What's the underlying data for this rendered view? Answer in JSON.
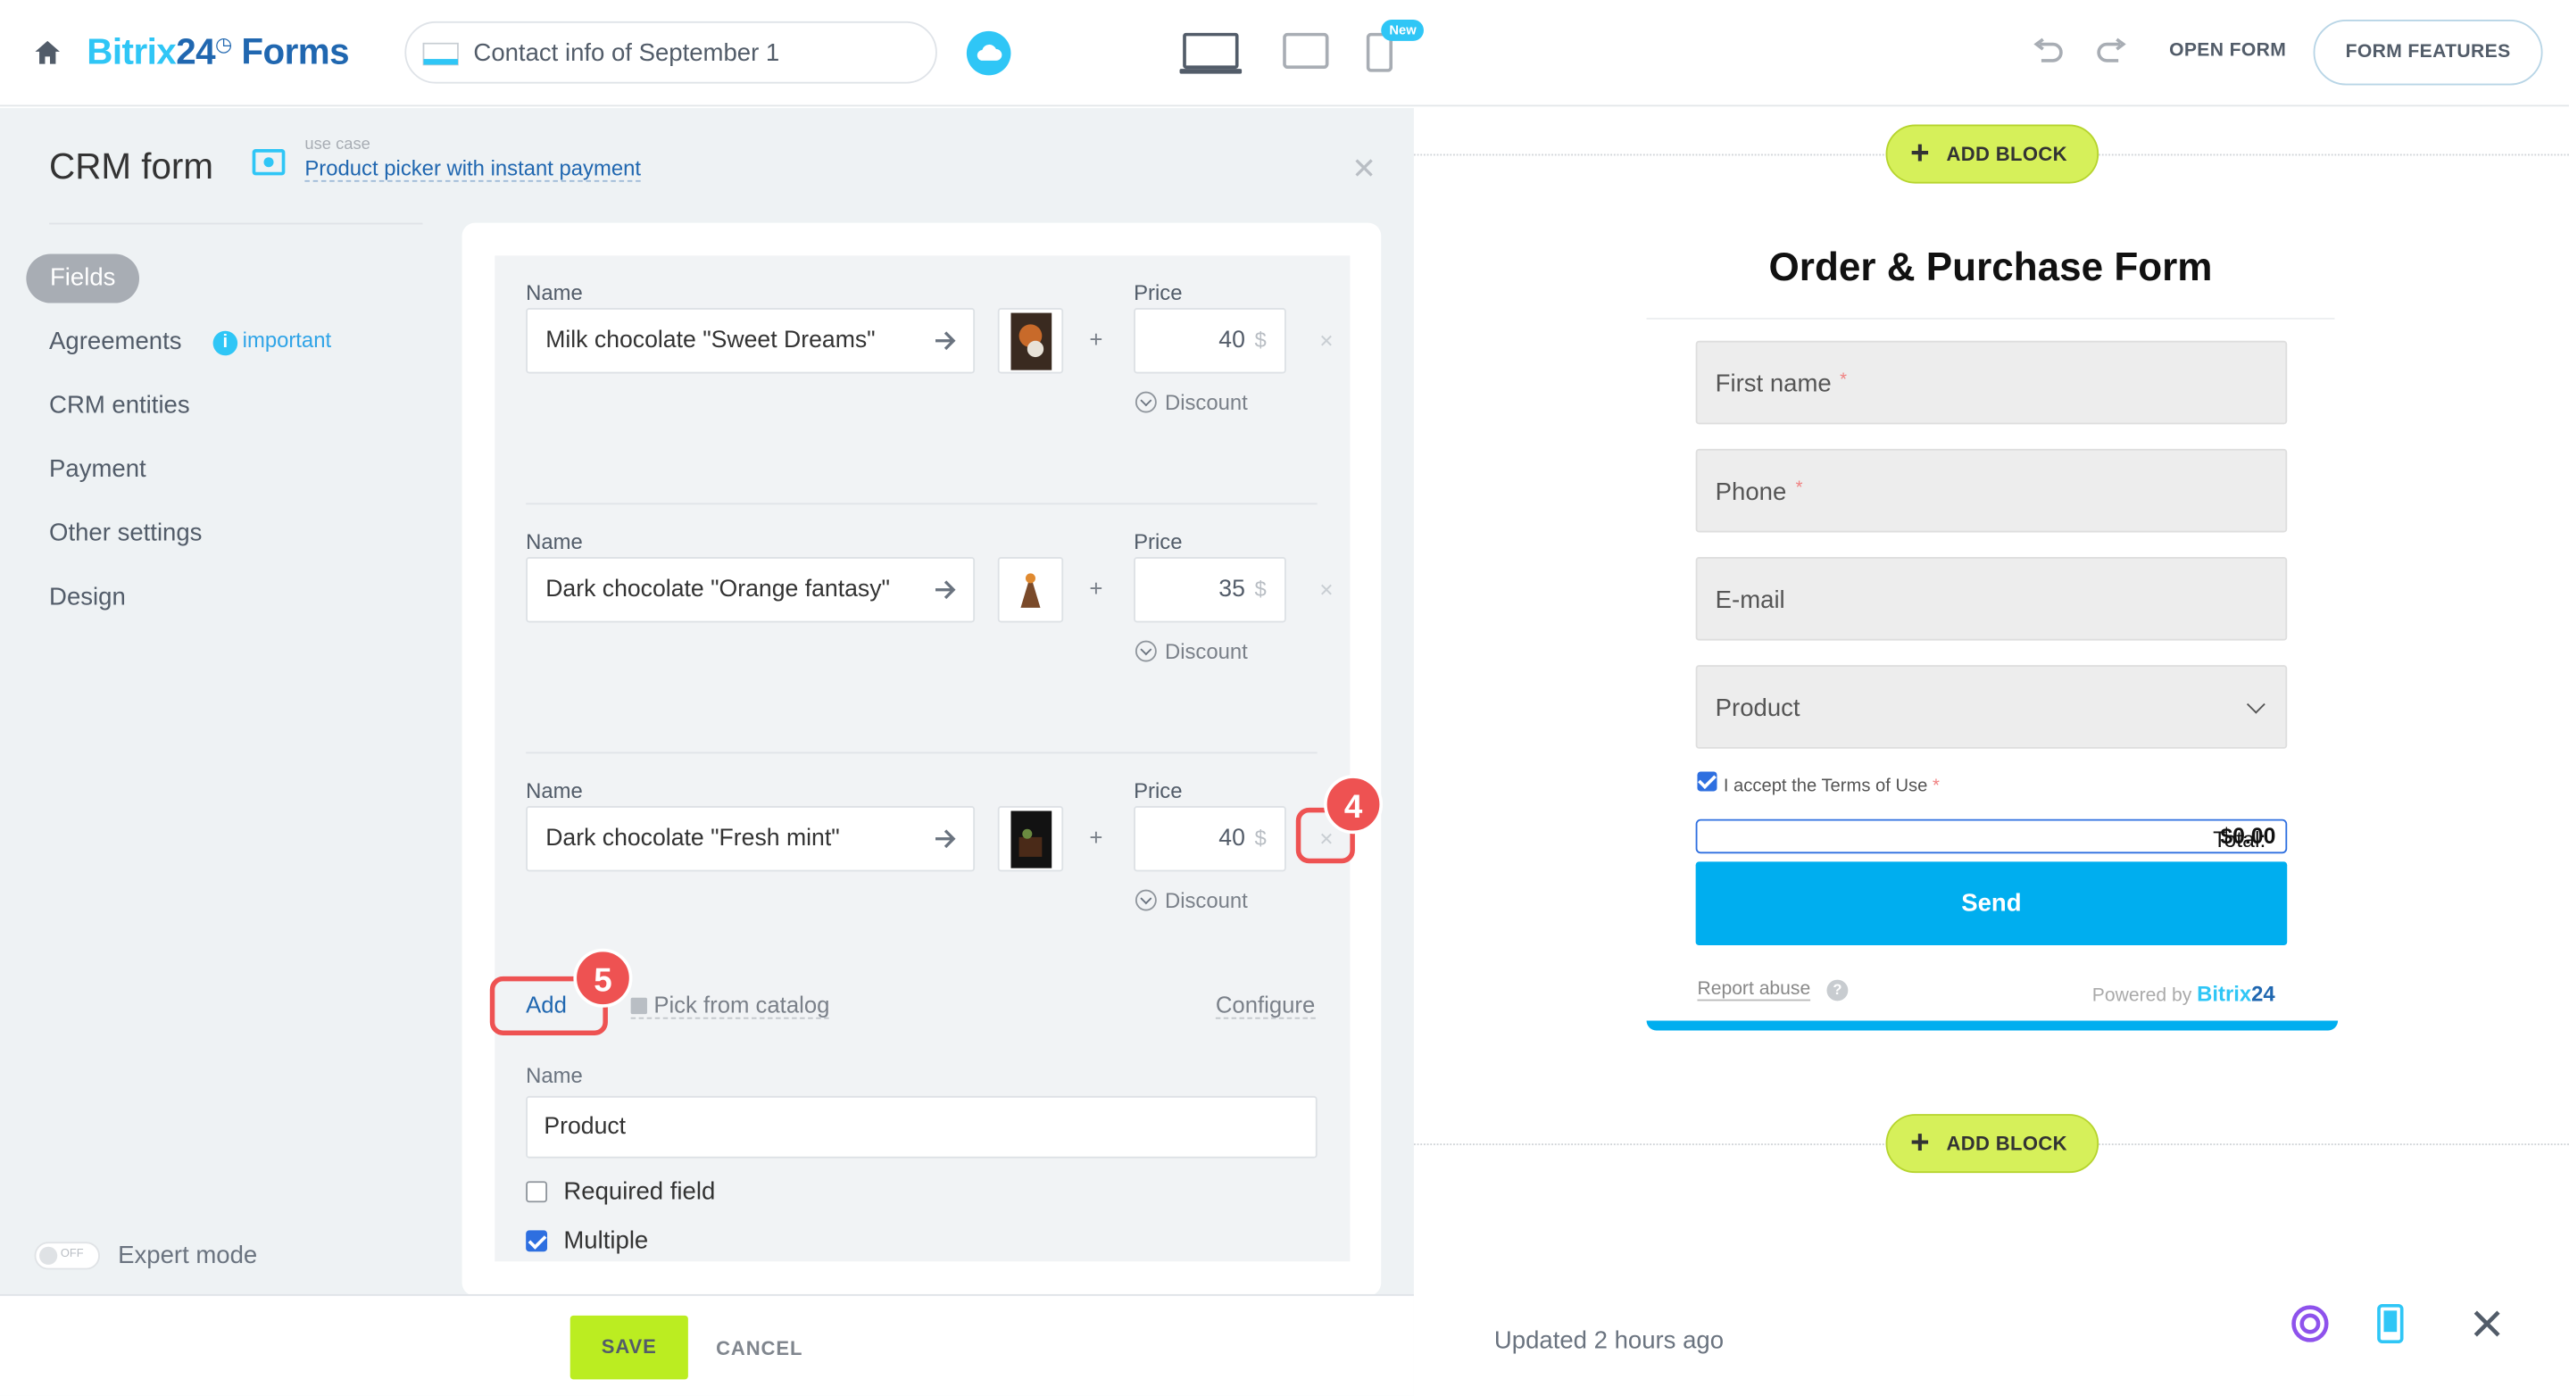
{
  "topbar": {
    "brand_part1": "Bitrix",
    "brand_part2": "24",
    "brand_part3": "Forms",
    "form_title": "Contact info of September 1",
    "new_badge": "New",
    "open_form": "OPEN FORM",
    "form_features": "FORM FEATURES"
  },
  "left": {
    "title": "CRM form",
    "usecase_label": "use case",
    "usecase_link": "Product picker with instant payment",
    "nav": [
      {
        "label": "Fields"
      },
      {
        "label": "Agreements"
      },
      {
        "label": "CRM entities"
      },
      {
        "label": "Payment"
      },
      {
        "label": "Other settings"
      },
      {
        "label": "Design"
      }
    ],
    "important_badge": "important",
    "toggle_text": "OFF",
    "expert_mode": "Expert mode"
  },
  "products": {
    "name_label": "Name",
    "price_label": "Price",
    "discount_label": "Discount",
    "currency": "$",
    "items": [
      {
        "name": "Milk chocolate \"Sweet Dreams\"",
        "price": "40"
      },
      {
        "name": "Dark chocolate \"Orange fantasy\"",
        "price": "35"
      },
      {
        "name": "Dark chocolate \"Fresh mint\"",
        "price": "40"
      }
    ],
    "add": "Add",
    "pick_from_catalog": "Pick from catalog",
    "configure": "Configure",
    "field_name_label": "Name",
    "field_name_value": "Product",
    "required_field": "Required field",
    "required_checked": false,
    "multiple": "Multiple",
    "multiple_checked": true
  },
  "annotations": {
    "marker4": "4",
    "marker5": "5"
  },
  "actions": {
    "save": "SAVE",
    "cancel": "CANCEL"
  },
  "preview": {
    "add_block": "ADD BLOCK",
    "form_title": "Order & Purchase Form",
    "fields": [
      {
        "label": "First name",
        "required": "*"
      },
      {
        "label": "Phone",
        "required": "*"
      },
      {
        "label": "E-mail"
      },
      {
        "label": "Product"
      }
    ],
    "terms": "I accept the Terms of Use",
    "terms_required": "*",
    "total_label": "Total:",
    "total_value": "$0.00",
    "send": "Send",
    "report_abuse": "Report abuse",
    "powered_by": "Powered by",
    "powered_brand1": "Bitrix",
    "powered_brand2": "24",
    "updated": "Updated 2 hours ago"
  },
  "colors": {
    "accent": "#2fc6f6",
    "brand_dark": "#2067b0",
    "save_green": "#bbed21",
    "highlight_red": "#ee5252",
    "send_blue": "#00aeef"
  }
}
